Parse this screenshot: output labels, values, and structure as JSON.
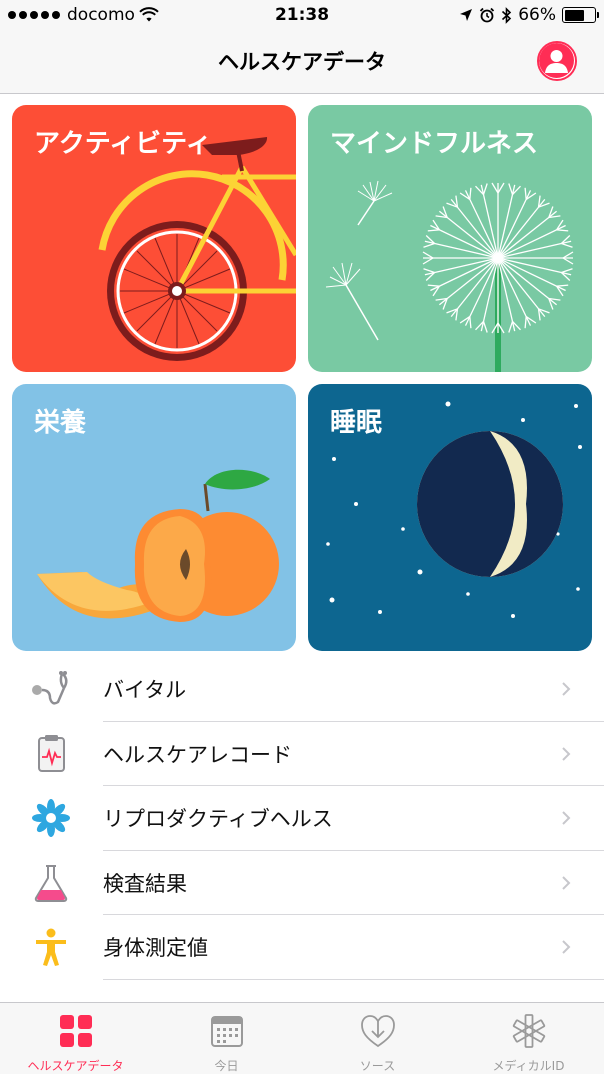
{
  "status_bar": {
    "carrier": "docomo",
    "time": "21:38",
    "battery": "66%",
    "battery_level": 0.66,
    "icons": [
      "signal-dots",
      "wifi-icon",
      "location-icon",
      "alarm-icon",
      "bluetooth-icon",
      "battery-icon"
    ]
  },
  "nav": {
    "title": "ヘルスケアデータ",
    "profile_icon": "person-icon",
    "accent": "#ff2d55"
  },
  "tiles": [
    {
      "label": "アクティビティ",
      "color": "#fd4e36",
      "art": "bicycle"
    },
    {
      "label": "マインドフルネス",
      "color": "#79c9a3",
      "art": "dandelion"
    },
    {
      "label": "栄養",
      "color": "#82c2e6",
      "art": "peach"
    },
    {
      "label": "睡眠",
      "color": "#0d6690",
      "art": "moon"
    }
  ],
  "list": [
    {
      "label": "バイタル",
      "icon": "stethoscope-icon"
    },
    {
      "label": "ヘルスケアレコード",
      "icon": "clipboard-icon"
    },
    {
      "label": "リプロダクティブヘルス",
      "icon": "flower-icon"
    },
    {
      "label": "検査結果",
      "icon": "flask-icon"
    },
    {
      "label": "身体測定値",
      "icon": "body-icon"
    }
  ],
  "tabs": [
    {
      "label": "ヘルスケアデータ",
      "icon": "grid-icon",
      "active": true
    },
    {
      "label": "今日",
      "icon": "calendar-icon",
      "active": false
    },
    {
      "label": "ソース",
      "icon": "download-heart-icon",
      "active": false
    },
    {
      "label": "メディカルID",
      "icon": "medical-star-icon",
      "active": false
    }
  ]
}
